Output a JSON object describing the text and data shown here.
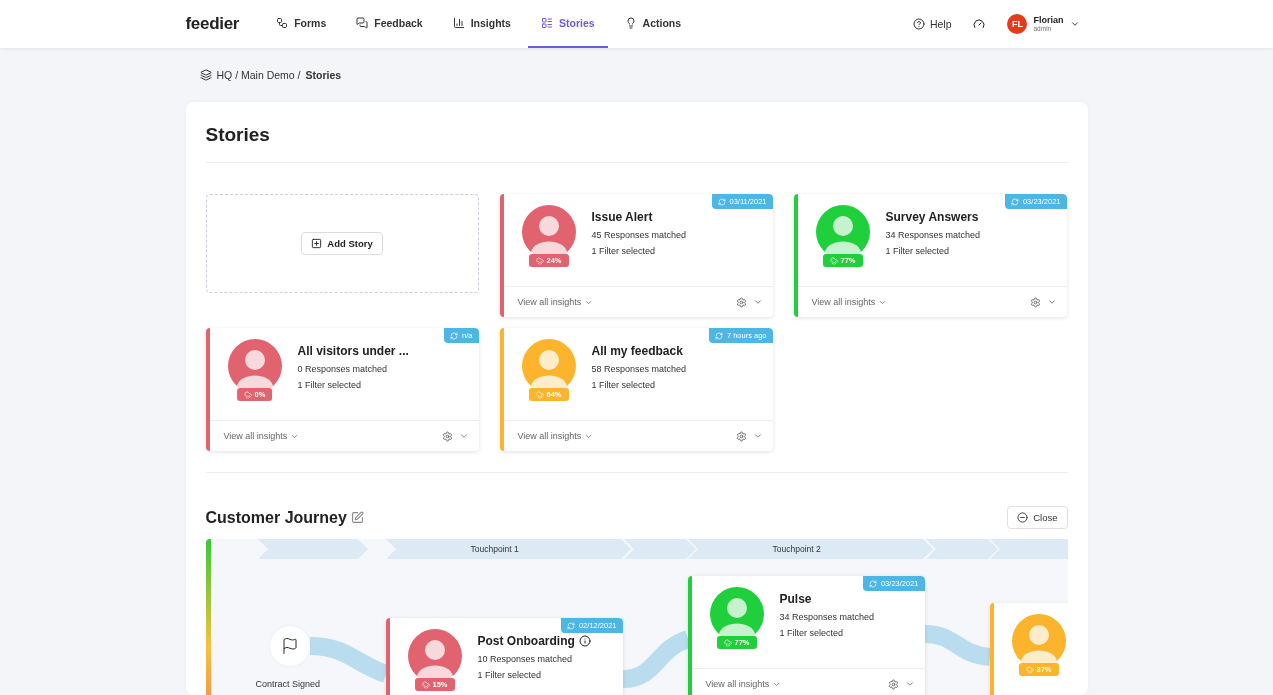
{
  "nav": {
    "logo": "feedier",
    "items": [
      {
        "label": "Forms",
        "selected": false
      },
      {
        "label": "Feedback",
        "selected": false
      },
      {
        "label": "Insights",
        "selected": false
      },
      {
        "label": "Stories",
        "selected": true
      },
      {
        "label": "Actions",
        "selected": false
      }
    ],
    "help": "Help",
    "user": {
      "initials": "FL",
      "name": "Florian",
      "role": "admin"
    }
  },
  "breadcrumb": {
    "path": "HQ / Main Demo /",
    "current": "Stories"
  },
  "stories": {
    "title": "Stories",
    "add_label": "Add Story",
    "cards": [
      {
        "title": "Issue Alert",
        "responses": "45 Responses matched",
        "filters": "1 Filter selected",
        "score": "24%",
        "updated": "03/11/2021",
        "color": "#e0636f",
        "link": "View all insights"
      },
      {
        "title": "Survey Answers",
        "responses": "34 Responses matched",
        "filters": "1 Filter selected",
        "score": "77%",
        "updated": "03/23/2021",
        "color": "#1fcf3c",
        "link": "View all insights"
      },
      {
        "title": "All visitors under ...",
        "responses": "0 Responses matched",
        "filters": "1 Filter selected",
        "score": "0%",
        "updated": "n/a",
        "color": "#e0636f",
        "link": "View all insights"
      },
      {
        "title": "All my feedback",
        "responses": "58 Responses matched",
        "filters": "1 Filter selected",
        "score": "64%",
        "updated": "7 hours ago",
        "color": "#fbb42c",
        "link": "View all insights"
      }
    ]
  },
  "journey": {
    "title": "Customer Journey",
    "close": "Close",
    "stages": [
      "Touchpoint 1",
      "Touchpoint 2"
    ],
    "start": "Contract Signed",
    "cards": [
      {
        "title": "Post Onboarding",
        "info": true,
        "responses": "10 Responses matched",
        "filters": "1 Filter selected",
        "score": "15%",
        "updated": "02/12/2021",
        "color": "#e0636f"
      },
      {
        "title": "Pulse",
        "info": false,
        "responses": "34 Responses matched",
        "filters": "1 Filter selected",
        "score": "77%",
        "updated": "03/23/2021",
        "color": "#1fcf3c",
        "link": "View all insights"
      },
      {
        "score": "37%",
        "color": "#fbb42c"
      }
    ]
  }
}
